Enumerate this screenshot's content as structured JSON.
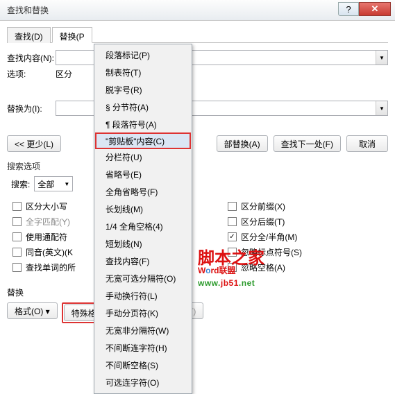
{
  "title": "查找和替换",
  "winbtns": {
    "help": "?",
    "close": "✕"
  },
  "tabs": {
    "find": "查找(D)",
    "replace": "替换(P"
  },
  "labels": {
    "find_what": "查找内容(N):",
    "options": "选项:",
    "options_val": "区分",
    "replace_with": "替换为(I):"
  },
  "buttons": {
    "less": "<<  更少(L)",
    "replace_all": "部替换(A)",
    "find_next": "查找下一处(F)",
    "cancel": "取消"
  },
  "search_opts_title": "搜索选项",
  "search_label": "搜索:",
  "search_value": "全部",
  "checks_left": [
    {
      "label": "区分大小写",
      "checked": false,
      "gray": false
    },
    {
      "label": "全字匹配(Y)",
      "checked": false,
      "gray": true
    },
    {
      "label": "使用通配符",
      "checked": false,
      "gray": false
    },
    {
      "label": "同音(英文)(K",
      "checked": false,
      "gray": false
    },
    {
      "label": "查找单词的所",
      "checked": false,
      "gray": false
    }
  ],
  "checks_right": [
    {
      "label": "区分前缀(X)",
      "checked": false,
      "gray": false
    },
    {
      "label": "区分后缀(T)",
      "checked": false,
      "gray": false
    },
    {
      "label": "区分全/半角(M)",
      "checked": true,
      "gray": false
    },
    {
      "label": "忽略标点符号(S)",
      "checked": false,
      "gray": false
    },
    {
      "label": "忽略空格(A)",
      "checked": false,
      "gray": false
    }
  ],
  "bottom": {
    "title": "替换",
    "format": "格式(O) ▾",
    "special": "特殊格式(E) ▾",
    "nolimit": "不限定格式(T)"
  },
  "menu": [
    "段落标记(P)",
    "制表符(T)",
    "脱字号(R)",
    "§ 分节符(A)",
    "¶ 段落符号(A)",
    "\"剪贴板\"内容(C)",
    "分栏符(U)",
    "省略号(E)",
    "全角省略号(F)",
    "长划线(M)",
    "1/4 全角空格(4)",
    "短划线(N)",
    "查找内容(F)",
    "无宽可选分隔符(O)",
    "手动换行符(L)",
    "手动分页符(K)",
    "无宽非分隔符(W)",
    "不间断连字符(H)",
    "不间断空格(S)",
    "可选连字符(O)"
  ],
  "watermark": {
    "cn": "脚本之家",
    "en_pre": "W",
    "en_o": "o",
    "en_post": "rd联盟",
    "url_a": "www.",
    "url_b": "jb51",
    "url_c": ".net"
  }
}
